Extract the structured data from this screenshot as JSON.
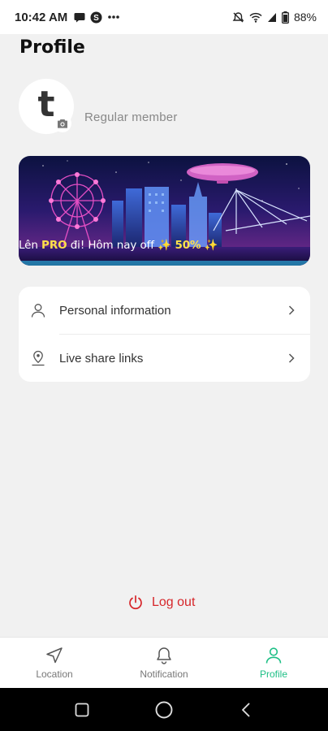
{
  "status_bar": {
    "time": "10:42 AM",
    "battery": "88%",
    "left_icons": [
      "chat-bubble-icon",
      "skype-icon",
      "more-dots-icon"
    ],
    "right_icons": [
      "mute-icon",
      "wifi-icon",
      "signal-icon",
      "battery-icon"
    ]
  },
  "header": {
    "title": "Profile"
  },
  "profile": {
    "avatar_letter": "t",
    "membership": "Regular member"
  },
  "banner": {
    "text_prefix": "Lên ",
    "text_pro": "PRO",
    "text_middle": " đi!  Hôm nay off ",
    "text_sparkle1": "✨",
    "text_percent": " 50%",
    "text_sparkle2": " ✨"
  },
  "menu": {
    "items": [
      {
        "label": "Personal information",
        "icon": "person-icon"
      },
      {
        "label": "Live share links",
        "icon": "location-pin-icon"
      }
    ]
  },
  "logout": {
    "label": "Log out"
  },
  "bottom_nav": {
    "items": [
      {
        "label": "Location",
        "icon": "navigation-arrow-icon",
        "active": false
      },
      {
        "label": "Notification",
        "icon": "bell-icon",
        "active": false
      },
      {
        "label": "Profile",
        "icon": "person-icon",
        "active": true
      }
    ]
  },
  "colors": {
    "accent": "#1dbf85",
    "danger": "#d6262a",
    "highlight": "#ffe14a",
    "background": "#f1f1f1"
  }
}
